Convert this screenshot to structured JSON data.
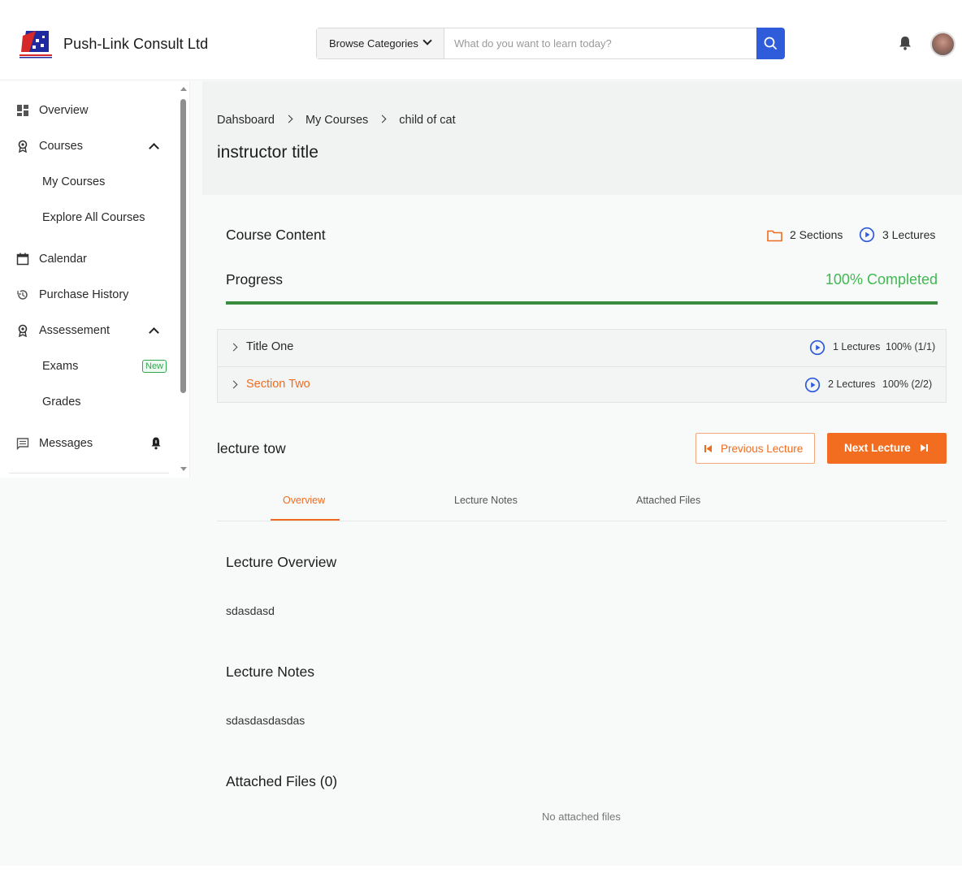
{
  "header": {
    "brand": "Push-Link Consult Ltd",
    "browse_label": "Browse Categories",
    "search_placeholder": "What do you want to learn today?"
  },
  "sidebar": {
    "items": [
      {
        "label": "Overview",
        "icon": "dashboard-icon"
      },
      {
        "label": "Courses",
        "icon": "award-icon"
      },
      {
        "label": "My Courses"
      },
      {
        "label": "Explore All Courses"
      },
      {
        "label": "Calendar",
        "icon": "calendar-icon"
      },
      {
        "label": "Purchase History",
        "icon": "history-icon"
      },
      {
        "label": "Assessement",
        "icon": "award-icon"
      },
      {
        "label": "Exams",
        "badge": "New"
      },
      {
        "label": "Grades"
      },
      {
        "label": "Messages",
        "icon": "message-icon"
      }
    ]
  },
  "breadcrumb": [
    "Dahsboard",
    "My Courses",
    "child of cat"
  ],
  "page_title": "instructor title",
  "course_content": {
    "title": "Course Content",
    "sections": "2 Sections",
    "lectures": "3 Lectures"
  },
  "progress": {
    "title": "Progress",
    "label": "100% Completed",
    "value": 1.0,
    "color": "#3fb950"
  },
  "sections": [
    {
      "title": "Title One",
      "lectures": "1 Lectures",
      "status": "100% (1/1)"
    },
    {
      "title": "Section Two",
      "lectures": "2 Lectures",
      "status": "100% (2/2)"
    }
  ],
  "lecture": {
    "title": "lecture tow",
    "prev_label": "Previous Lecture",
    "next_label": "Next Lecture"
  },
  "tabs": [
    "Overview",
    "Lecture Notes",
    "Attached Files"
  ],
  "content": {
    "overview_title": "Lecture Overview",
    "overview_body": "sdasdasd",
    "notes_title": "Lecture Notes",
    "notes_body": "sdasdasdasdas",
    "files_title": "Attached Files (0)",
    "files_empty": "No attached files"
  },
  "colors": {
    "accent": "#f26d1f",
    "primary": "#2f5cdb",
    "success": "#3fb950"
  }
}
